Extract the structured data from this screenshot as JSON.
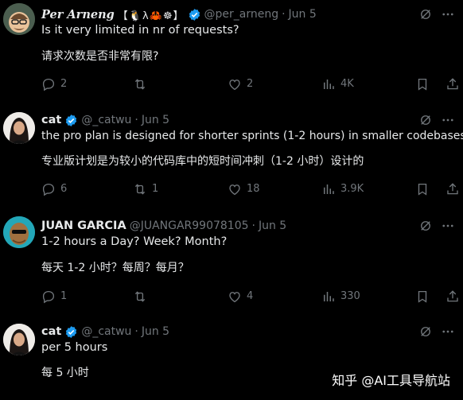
{
  "tweets": [
    {
      "name": "Per Arneng",
      "name_suffix": "【🐧λ🦀☸】",
      "handle": "@per_arneng",
      "date": "Jun 5",
      "text_en": "Is it very limited in nr of requests?",
      "text_zh": "请求次数是否非常有限?",
      "replies": "2",
      "retweets": "",
      "likes": "2",
      "views": "4K"
    },
    {
      "name": "cat",
      "handle": "@_catwu",
      "date": "Jun 5",
      "text_en": "the pro plan is designed for shorter sprints (1-2 hours) in smaller codebases",
      "text_zh": "专业版计划是为较小的代码库中的短时间冲刺（1-2 小时）设计的",
      "replies": "6",
      "retweets": "1",
      "likes": "18",
      "views": "3.9K"
    },
    {
      "name": "JUAN GARCIA",
      "handle": "@JUANGAR99078105",
      "date": "Jun 5",
      "text_en": "1-2 hours a Day? Week? Month?",
      "text_zh": "每天 1-2 小时？每周？每月？",
      "replies": "1",
      "retweets": "",
      "likes": "4",
      "views": "330"
    },
    {
      "name": "cat",
      "handle": "@_catwu",
      "date": "Jun 5",
      "text_en": "per 5 hours",
      "text_zh": "每 5 小时"
    }
  ],
  "watermark": "知乎 @AI工具导航站",
  "colors": {
    "accent": "#1d9bf0",
    "muted": "#71767b",
    "text": "#e7e9ea",
    "background": "#000000"
  }
}
